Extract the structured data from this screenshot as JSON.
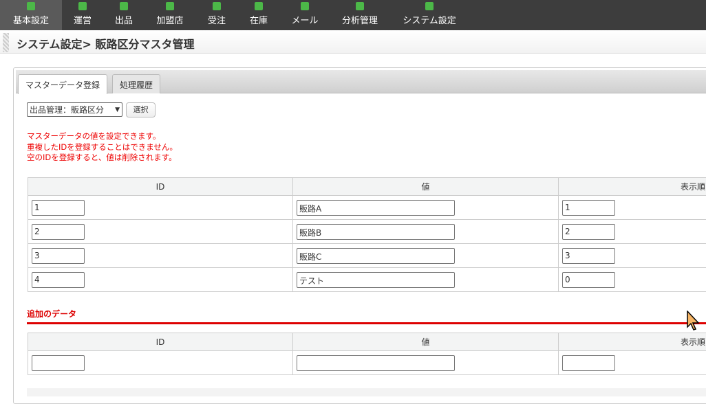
{
  "nav": [
    {
      "label": "基本設定",
      "active": true
    },
    {
      "label": "運営"
    },
    {
      "label": "出品"
    },
    {
      "label": "加盟店"
    },
    {
      "label": "受注"
    },
    {
      "label": "在庫"
    },
    {
      "label": "メール"
    },
    {
      "label": "分析管理"
    },
    {
      "label": "システム設定"
    }
  ],
  "breadcrumb": "システム設定> 販路区分マスタ管理",
  "tabs": [
    "マスターデータ登録",
    "処理履歴"
  ],
  "select": {
    "value": "出品管理：販路区分",
    "button": "選択"
  },
  "notes": [
    "マスターデータの値を設定できます。",
    "重複したIDを登録することはできません。",
    "空のIDを登録すると、値は削除されます。"
  ],
  "columns": [
    "ID",
    "値",
    "表示順"
  ],
  "rows": [
    {
      "id": "1",
      "value": "販路A",
      "order": "1"
    },
    {
      "id": "2",
      "value": "販路B",
      "order": "2"
    },
    {
      "id": "3",
      "value": "販路C",
      "order": "3"
    },
    {
      "id": "4",
      "value": "テスト",
      "order": "0"
    }
  ],
  "add_section": {
    "title": "追加のデータ"
  },
  "colors": {
    "nav_bg": "#3d3d3d",
    "icon": "#4cb848",
    "error": "#e00000"
  }
}
